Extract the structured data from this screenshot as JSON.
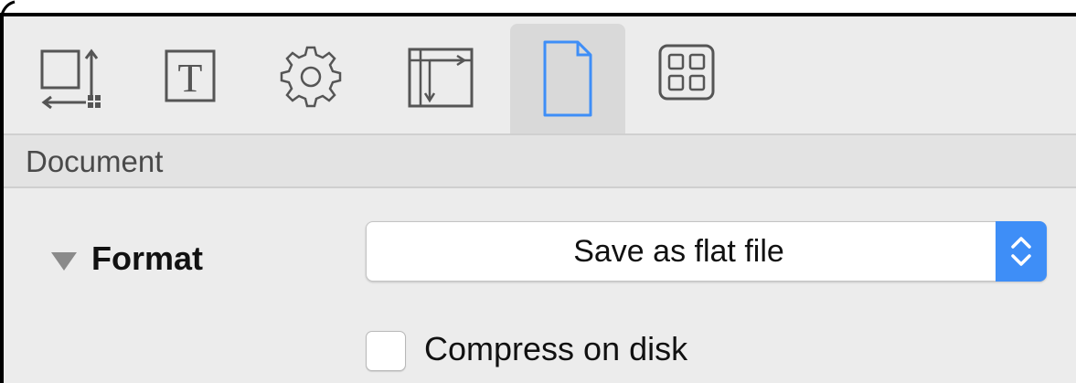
{
  "toolbar": {
    "items": [
      {
        "icon": "size-position-icon",
        "selected": false
      },
      {
        "icon": "text-icon",
        "label": "T",
        "selected": false
      },
      {
        "icon": "gear-icon",
        "selected": false
      },
      {
        "icon": "layout-icon",
        "selected": false
      },
      {
        "icon": "document-icon",
        "selected": true
      },
      {
        "icon": "grid-icon",
        "selected": false
      }
    ]
  },
  "section": {
    "title": "Document"
  },
  "format": {
    "label": "Format",
    "popup_value": "Save as flat file",
    "compress_label": "Compress on disk",
    "compress_checked": false
  },
  "colors": {
    "accent": "#3e8ef7",
    "icon": "#555555",
    "background": "#ececec"
  }
}
